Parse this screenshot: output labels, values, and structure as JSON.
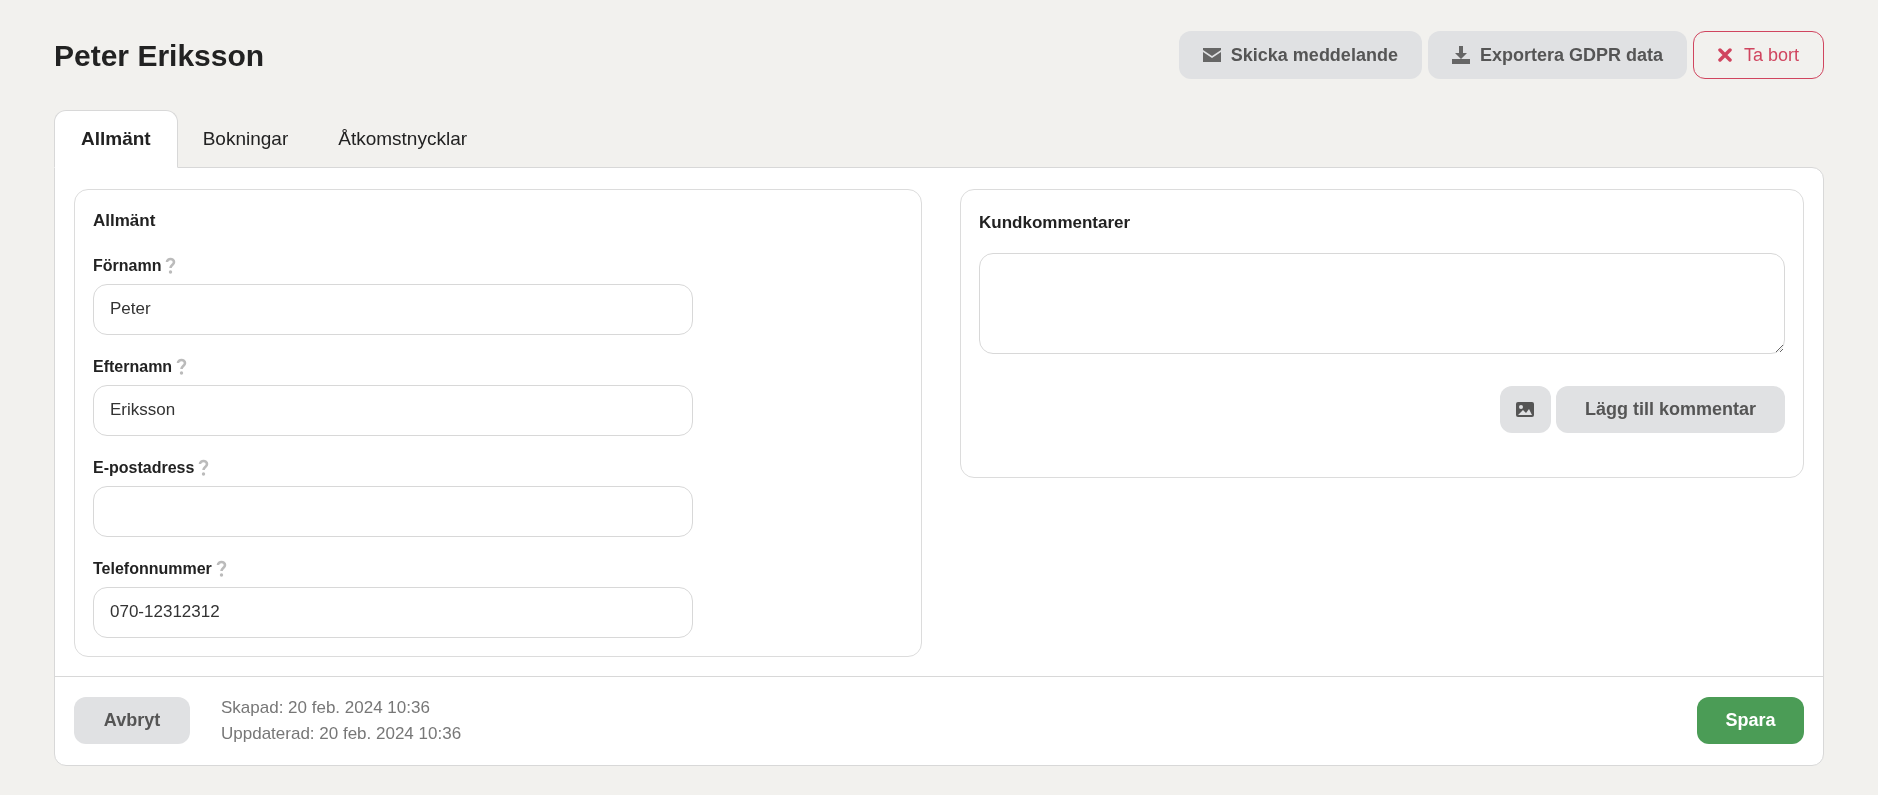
{
  "title": "Peter Eriksson",
  "actions": [
    {
      "kind": "mail",
      "label": "Skicka meddelande"
    },
    {
      "kind": "download",
      "label": "Exportera GDPR data"
    },
    {
      "kind": "delete",
      "label": "Ta bort"
    }
  ],
  "tabs": [
    {
      "label": "Allmänt",
      "selected": true
    },
    {
      "label": "Bokningar",
      "selected": false
    },
    {
      "label": "Åtkomstnycklar",
      "selected": false
    }
  ],
  "general": {
    "title": "Allmänt",
    "fields": [
      {
        "label": "Förnamn",
        "value": "Peter"
      },
      {
        "label": "Efternamn",
        "value": "Eriksson"
      },
      {
        "label": "E-postadress"
      },
      {
        "label": "Telefonnummer",
        "value": "070-12312312"
      }
    ]
  },
  "comments": {
    "title": "Kundkommentarer",
    "add_button": "Lägg till kommentar"
  },
  "footer": {
    "cancel": "Avbryt",
    "created": "Skapad: 20 feb. 2024 10:36",
    "updated": "Uppdaterad: 20 feb. 2024 10:36",
    "save": "Spara"
  }
}
